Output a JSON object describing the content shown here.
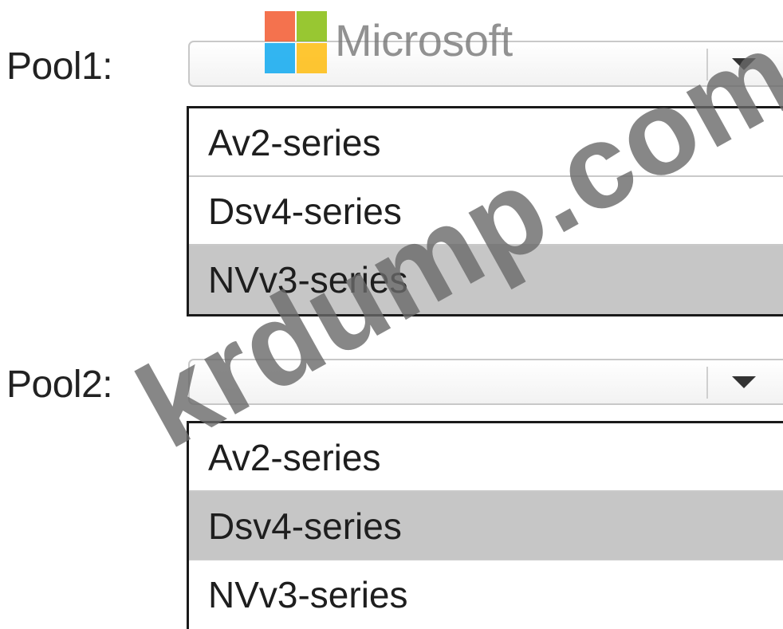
{
  "pools": [
    {
      "label": "Pool1:",
      "selected_value": "",
      "options": [
        "Av2-series",
        "Dsv4-series",
        "NVv3-series"
      ],
      "highlighted_index": 2
    },
    {
      "label": "Pool2:",
      "selected_value": "",
      "options": [
        "Av2-series",
        "Dsv4-series",
        "NVv3-series"
      ],
      "highlighted_index": 1
    }
  ],
  "logo": {
    "text": "Microsoft",
    "colors": {
      "red": "#f25022",
      "green": "#7fba00",
      "blue": "#00a4ef",
      "yellow": "#ffb900"
    }
  },
  "watermark": {
    "text": "krdump.com"
  },
  "colors": {
    "highlight": "#c6c6c6",
    "list_border": "#1a1a1a",
    "text": "#1e1e1e"
  }
}
